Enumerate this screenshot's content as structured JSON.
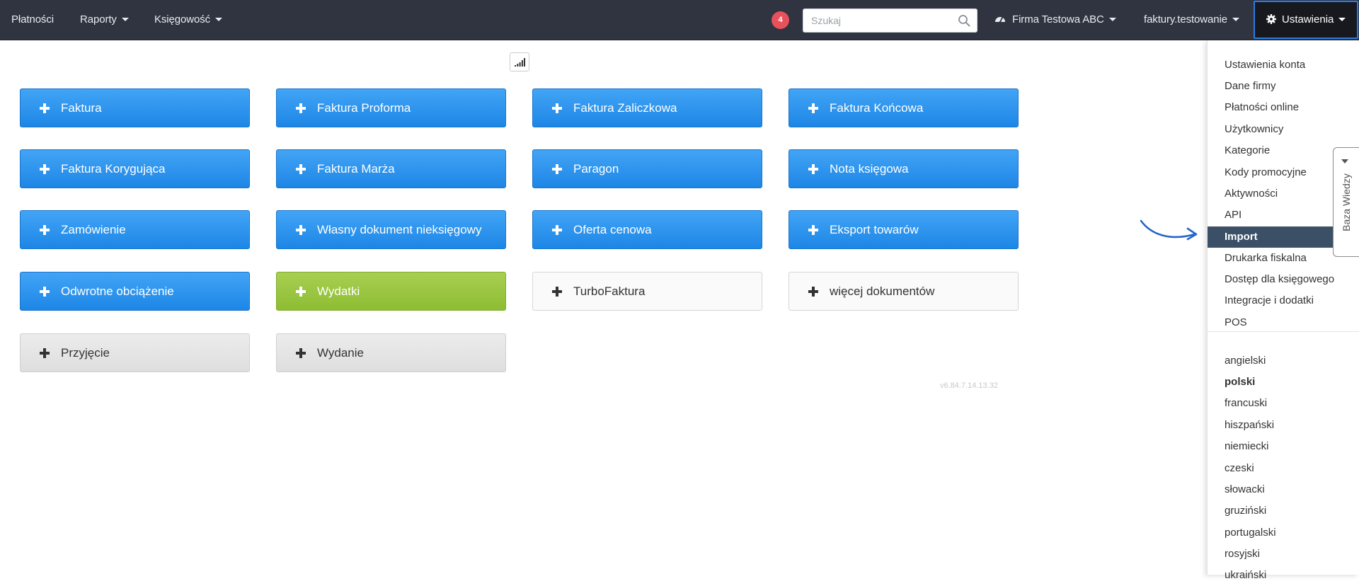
{
  "navbar": {
    "platnosci": "Płatności",
    "raporty": "Raporty",
    "ksiegowosc": "Księgowość",
    "notification_count": "4",
    "search_placeholder": "Szukaj",
    "company": "Firma Testowa ABC",
    "account": "faktury.testowanie",
    "settings": "Ustawienia"
  },
  "toolbar": {
    "signal_icon": "signal-bars-icon"
  },
  "documents": [
    "Faktura",
    "Faktura Proforma",
    "Faktura Zaliczkowa",
    "Faktura Końcowa",
    "Faktura Korygująca",
    "Faktura Marża",
    "Paragon",
    "Nota księgowa",
    "Zamówienie",
    "Własny dokument nieksięgowy",
    "Oferta cenowa",
    "Eksport towarów",
    "Odwrotne obciążenie",
    "Wydatki",
    "TurboFaktura",
    "więcej dokumentów",
    "Przyjęcie",
    "Wydanie"
  ],
  "version": "v6.84.7.14.13.32",
  "settings_menu": [
    "Ustawienia konta",
    "Dane firmy",
    "Płatności online",
    "Użytkownicy",
    "Kategorie",
    "Kody promocyjne",
    "Aktywności",
    "API",
    "Import",
    "Drukarka fiskalna",
    "Dostęp dla księgowego",
    "Integracje i dodatki",
    "POS"
  ],
  "active_menu_item": "Import",
  "languages": [
    "angielski",
    "polski",
    "francuski",
    "hiszpański",
    "niemiecki",
    "czeski",
    "słowacki",
    "gruziński",
    "portugalski",
    "rosyjski",
    "ukraiński"
  ],
  "current_language": "polski",
  "knowledge_base_tab": "Baza Wiedzy",
  "colors": {
    "navbar": "#2f3440",
    "primary_blue": "#1d86e6",
    "green": "#8dbd33",
    "menu_active": "#3b5066",
    "badge": "#e8515b",
    "focus_border": "#2d7be5"
  }
}
